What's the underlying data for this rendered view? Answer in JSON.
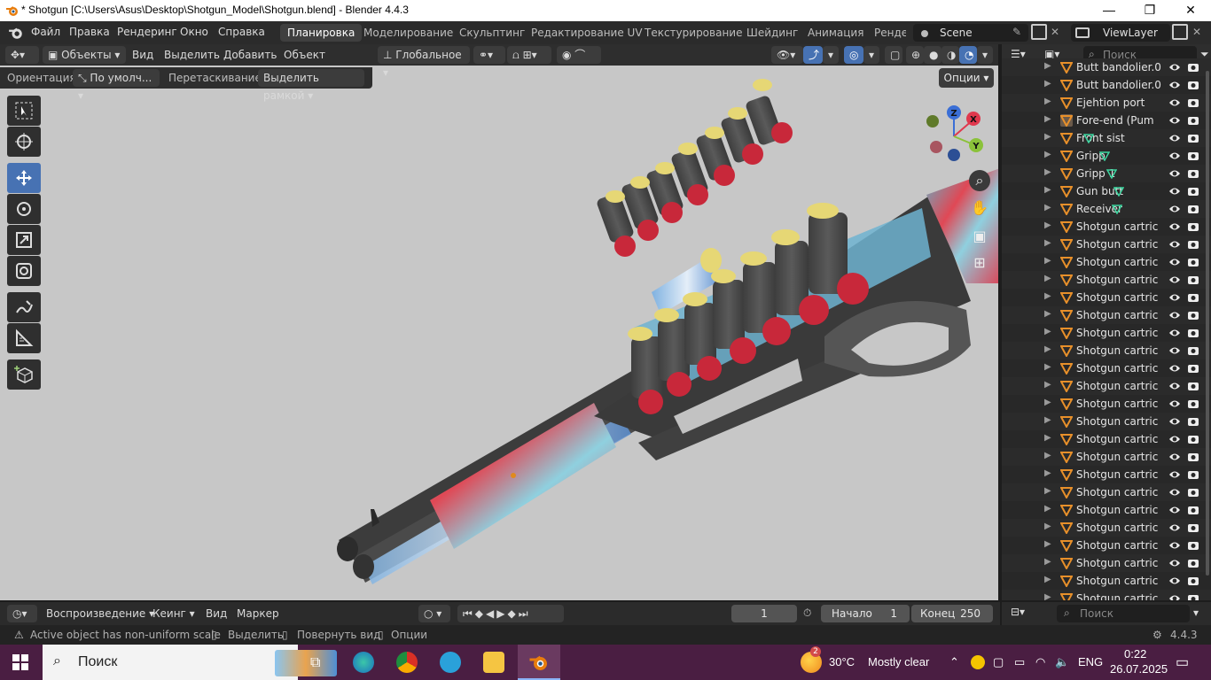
{
  "window": {
    "title": "* Shotgun [C:\\Users\\Asus\\Desktop\\Shotgun_Model\\Shotgun.blend] - Blender 4.4.3",
    "minimize": "—",
    "maximize": "❐",
    "close": "✕"
  },
  "menu": [
    "Файл",
    "Правка",
    "Рендеринг",
    "Окно",
    "Справка"
  ],
  "workspaces": [
    "Планировка",
    "Моделирование",
    "Скульптинг",
    "Редактирование UV",
    "Текстурирование",
    "Шейдинг",
    "Анимация",
    "Ренде"
  ],
  "active_workspace": "Планировка",
  "scene": "Scene",
  "view_layer": "ViewLayer",
  "viewport": {
    "mode": "Объекты",
    "menus": [
      "Вид",
      "Выделить",
      "Добавить",
      "Объект"
    ],
    "transform_orientation": "Глобальное",
    "orientation_label": "Ориентация:",
    "orientation_value": "По умолч...",
    "drag_label": "Перетаскивание:",
    "drag_value": "Выделить рамкой",
    "options": "Опции",
    "gizmo": {
      "x": "X",
      "y": "Y",
      "z": "Z"
    }
  },
  "outliner": {
    "search_placeholder": "Поиск",
    "items": [
      "Butt bandolier.0",
      "Butt bandolier.0",
      "Ejehtion port",
      "Fore-end (Pum",
      "Front sist",
      "Gripp",
      "Gripp 1",
      "Gun butt",
      "Receiver",
      "Shotgun cartric",
      "Shotgun cartric",
      "Shotgun cartric",
      "Shotgun cartric",
      "Shotgun cartric",
      "Shotgun cartric",
      "Shotgun cartric",
      "Shotgun cartric",
      "Shotgun cartric",
      "Shotgun cartric",
      "Shotgun cartric",
      "Shotgun cartric",
      "Shotgun cartric",
      "Shotgun cartric",
      "Shotgun cartric",
      "Shotgun cartric",
      "Shotgun cartric",
      "Shotgun cartric",
      "Shotgun cartric",
      "Shotgun cartric",
      "Shotgun cartric",
      "Shotgun cartric",
      "Shotgun cartric"
    ]
  },
  "timeline": {
    "playback": "Воспроизведение",
    "keying": "Кеинг",
    "view": "Вид",
    "marker": "Маркер",
    "current_frame": "1",
    "start_label": "Начало",
    "start_value": "1",
    "end_label": "Конец",
    "end_value": "250"
  },
  "properties": {
    "search_placeholder": "Поиск"
  },
  "status": {
    "warning": "Active object has non-uniform scale",
    "select": "Выделить",
    "rotate": "Повернуть вид",
    "options": "Опции",
    "version": "4.4.3"
  },
  "taskbar": {
    "search": "Поиск",
    "weather_temp": "30°C",
    "weather_desc": "Mostly clear",
    "lang": "ENG",
    "time": "0:22",
    "date": "26.07.2025",
    "weather_badge": "2"
  }
}
